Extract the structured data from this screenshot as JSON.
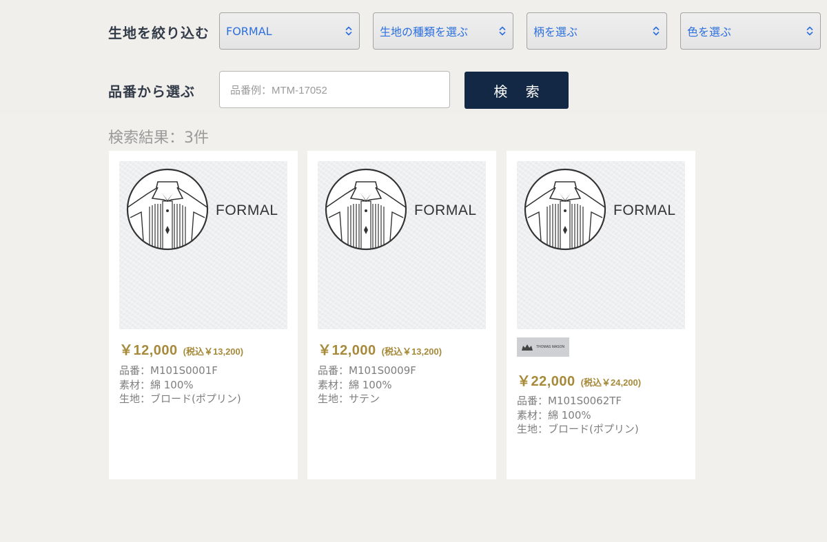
{
  "filters": {
    "fabric_label": "生地を絞り込む",
    "selects": [
      {
        "value": "FORMAL"
      },
      {
        "value": "生地の種類を選ぶ"
      },
      {
        "value": "柄を選ぶ"
      },
      {
        "value": "色を選ぶ"
      }
    ],
    "product_number_label": "品番から選ぶ",
    "search_placeholder": "品番例：MTM-17052",
    "search_button": "検 索"
  },
  "results": {
    "count_text": "検索結果：3件",
    "items": [
      {
        "image_text": "FORMAL",
        "price": "￥12,000",
        "tax_price": "(税込￥13,200)",
        "product_no": "品番：M101S0001F",
        "material": "素材：綿 100%",
        "fabric": "生地：ブロード(ポプリン)"
      },
      {
        "image_text": "FORMAL",
        "price": "￥12,000",
        "tax_price": "(税込￥13,200)",
        "product_no": "品番：M101S0009F",
        "material": "素材：綿 100%",
        "fabric": "生地：サテン"
      },
      {
        "image_text": "FORMAL",
        "brand_logo": "THOMAS MASON",
        "price": "￥22,000",
        "tax_price": "(税込￥24,200)",
        "product_no": "品番：M101S0062TF",
        "material": "素材：綿 100%",
        "fabric": "生地：ブロード(ポプリン)"
      }
    ]
  },
  "colors": {
    "accent_navy": "#132844",
    "price_gold": "#a68a3a",
    "select_text": "#2b6fe0"
  },
  "icons": [
    "chevron-updown-icon",
    "formal-shirt-icon",
    "thomas-mason-logo"
  ]
}
